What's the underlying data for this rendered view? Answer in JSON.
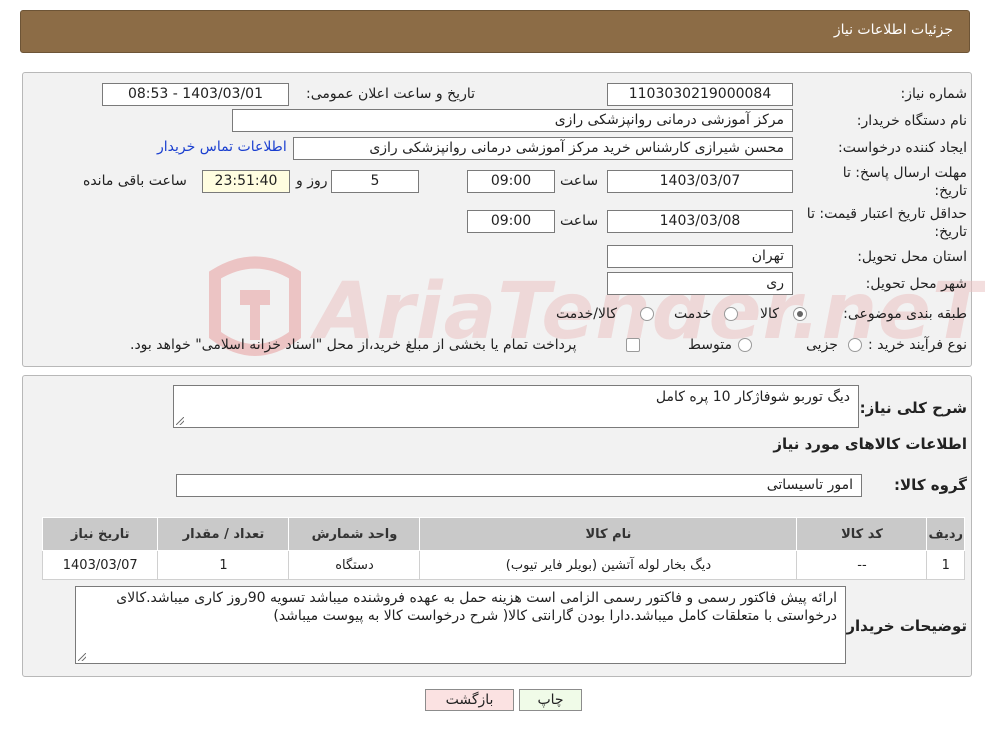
{
  "header": {
    "title": "جزئیات اطلاعات نیاز"
  },
  "form": {
    "need_number": {
      "label": "شماره نیاز:",
      "value": "1103030219000084"
    },
    "announce_datetime": {
      "label": "تاریخ و ساعت اعلان عمومی:",
      "value": "1403/03/01 - 08:53"
    },
    "buyer_org": {
      "label": "نام دستگاه خریدار:",
      "value": "مرکز آموزشی درمانی روانپزشکی رازی"
    },
    "requester": {
      "label": "ایجاد کننده درخواست:",
      "value": "محسن شیرازی کارشناس خرید مرکز آموزشی درمانی روانپزشکی رازی",
      "contact_link": "اطلاعات تماس خریدار"
    },
    "reply_deadline": {
      "label_line1": "مهلت ارسال پاسخ: تا",
      "label_line2": "تاریخ:",
      "date": "1403/03/07",
      "time_label": "ساعت",
      "time": "09:00",
      "days": "5",
      "days_label": "روز و",
      "remaining": "23:51:40",
      "remaining_label": "ساعت باقی مانده"
    },
    "price_validity": {
      "label_line1": "حداقل تاریخ اعتبار قیمت: تا",
      "label_line2": "تاریخ:",
      "date": "1403/03/08",
      "time_label": "ساعت",
      "time": "09:00"
    },
    "province": {
      "label": "استان محل تحویل:",
      "value": "تهران"
    },
    "city": {
      "label": "شهر محل تحویل:",
      "value": "ری"
    },
    "category": {
      "label": "طبقه بندی موضوعی:",
      "options": [
        "کالا",
        "خدمت",
        "کالا/خدمت"
      ],
      "selected": "کالا"
    },
    "process_type": {
      "label": "نوع فرآیند خرید :",
      "options": [
        "جزیی",
        "متوسط"
      ],
      "note": "پرداخت تمام یا بخشی از مبلغ خرید،از محل \"اسناد خزانه اسلامی\" خواهد بود."
    }
  },
  "details": {
    "summary_label": "شرح کلی نیاز:",
    "summary_value": "دیگ توربو شوفاژکار 10 پره کامل",
    "items_title": "اطلاعات کالاهای مورد نیاز",
    "group_label": "گروه کالا:",
    "group_value": "امور تاسیساتی",
    "table": {
      "headers": [
        "ردیف",
        "کد کالا",
        "نام کالا",
        "واحد شمارش",
        "تعداد / مقدار",
        "تاریخ نیاز"
      ],
      "rows": [
        [
          "1",
          "--",
          "دیگ بخار لوله آتشین (بویلر فایر تیوب)",
          "دستگاه",
          "1",
          "1403/03/07"
        ]
      ]
    },
    "buyer_notes_label": "توضیحات خریدار:",
    "buyer_notes_value": "ارائه پیش فاکتور رسمی و فاکتور رسمی الزامی است هزینه حمل به عهده فروشنده میباشد تسویه 90روز کاری میباشد.کالای درخواستی با متعلقات کامل میباشد.دارا بودن گارانتی کالا( شرح درخواست کالا به پیوست میباشد)"
  },
  "buttons": {
    "print": "چاپ",
    "back": "بازگشت"
  },
  "watermark": {
    "text": "AriaTender.neT",
    "color": "#e05050"
  }
}
